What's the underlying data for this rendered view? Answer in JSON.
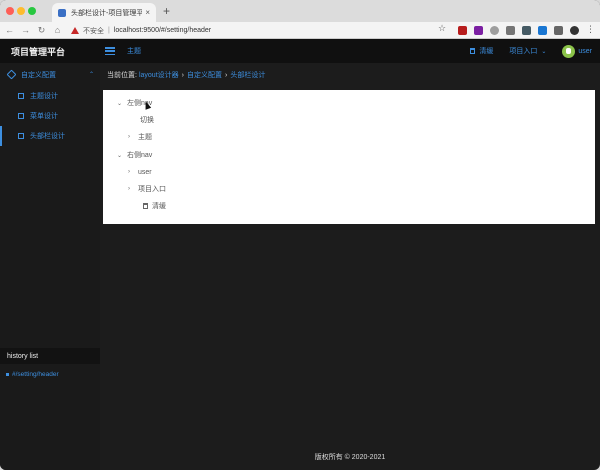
{
  "browser": {
    "tab_title": "头部栏设计-项目管理平台",
    "tab_close": "×",
    "new_tab": "+",
    "insecure_label": "不安全",
    "url_separator": "|",
    "url": "localhost:9500/#/setting/header"
  },
  "header": {
    "brand": "项目管理平台",
    "tab": "主题",
    "clear": "清缓",
    "project_entry": "项目入口",
    "user": "user"
  },
  "sidebar": {
    "group_label": "自定义配置",
    "items": [
      {
        "label": "主题设计",
        "active": false
      },
      {
        "label": "菜单设计",
        "active": false
      },
      {
        "label": "头部栏设计",
        "active": true
      }
    ],
    "history_title": "history list",
    "history_items": [
      "#/setting/header"
    ]
  },
  "breadcrumb": {
    "prefix": "当前位置:",
    "items": [
      "layout设计器",
      "自定义配置",
      "头部栏设计"
    ],
    "separator": "›"
  },
  "tree": {
    "left_nav": "左侧nav",
    "toggle": "切换",
    "theme": "主题",
    "right_nav": "右侧nav",
    "user": "user",
    "project_entry": "项目入口",
    "clear": "清缓"
  },
  "footer": "版权所有 © 2020-2021",
  "colors": {
    "accent": "#3d8fe0",
    "page_bg": "#1c1c1c",
    "sidebar_bg": "#1a1a1a"
  }
}
